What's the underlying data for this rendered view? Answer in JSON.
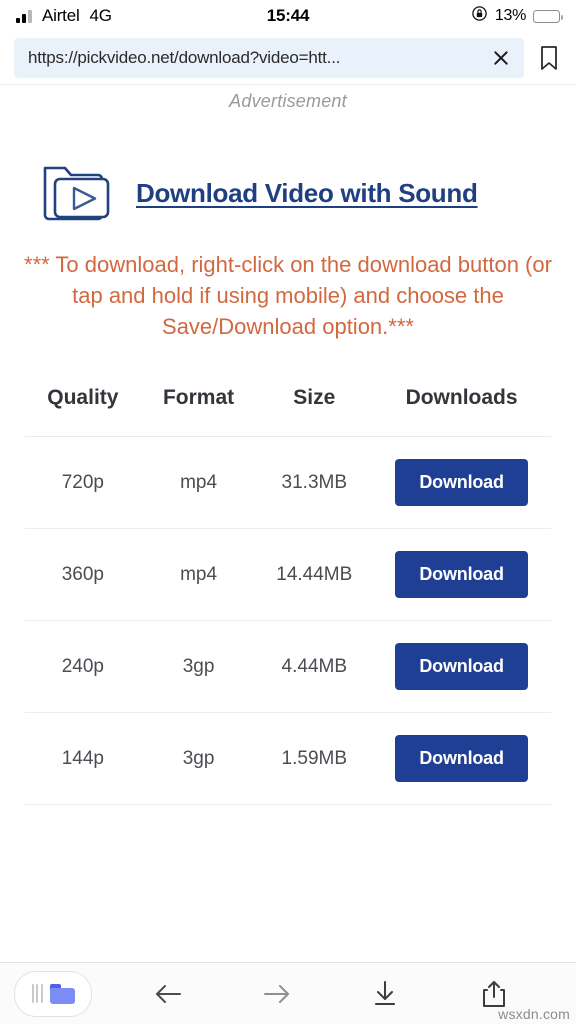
{
  "status_bar": {
    "carrier": "Airtel",
    "network": "4G",
    "time": "15:44",
    "battery_percent": "13%",
    "rotation_lock_icon": "rotation-lock-icon",
    "signal_icon": "signal-bars-icon",
    "battery_icon": "battery-low-icon",
    "battery_color": "#f03d2f"
  },
  "browser": {
    "url": "https://pickvideo.net/download?video=htt...",
    "url_placeholder": "Search or enter website name",
    "clear_icon": "close-icon",
    "bookmark_icon": "bookmark-icon"
  },
  "page": {
    "ad_label": "Advertisement",
    "promo": {
      "icon": "folder-video-play-icon",
      "link_text": "Download Video with Sound",
      "link_color": "#1f3f80"
    },
    "notice": "*** To download, right-click on the download button (or tap and hold if using mobile) and choose the Save/Download option.***",
    "notice_color": "#d2683f",
    "table": {
      "headers": [
        "Quality",
        "Format",
        "Size",
        "Downloads"
      ],
      "action_label": "Download",
      "button_color": "#1e3f94",
      "rows": [
        {
          "quality": "720p",
          "format": "mp4",
          "size": "31.3MB",
          "action": "Download"
        },
        {
          "quality": "360p",
          "format": "mp4",
          "size": "14.44MB",
          "action": "Download"
        },
        {
          "quality": "240p",
          "format": "3gp",
          "size": "4.44MB",
          "action": "Download"
        },
        {
          "quality": "144p",
          "format": "3gp",
          "size": "1.59MB",
          "action": "Download"
        }
      ]
    }
  },
  "bottom_bar": {
    "tabs_icon": "tabs-folder-icon",
    "back_icon": "arrow-left-icon",
    "forward_icon": "arrow-right-icon",
    "download_icon": "download-arrow-icon",
    "share_icon": "share-icon",
    "watermark": "wsxdn.com"
  }
}
